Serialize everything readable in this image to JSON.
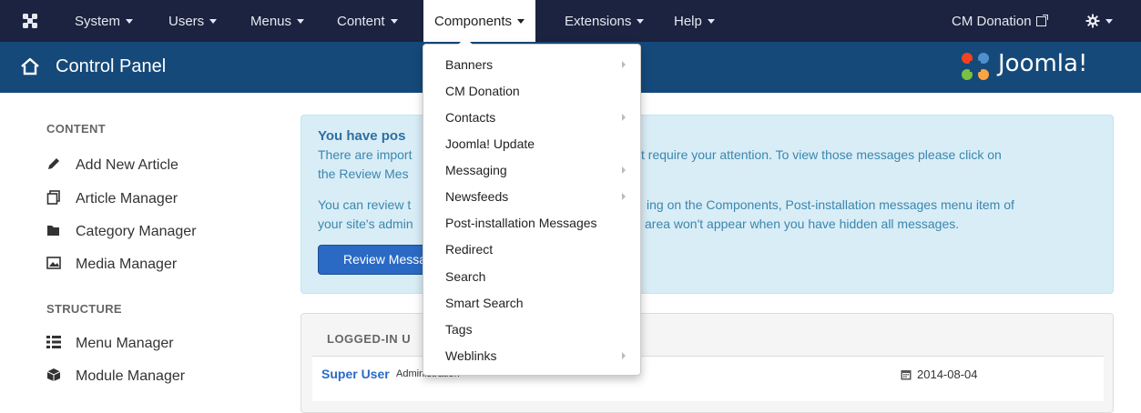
{
  "navbar": {
    "menus": [
      {
        "label": "System"
      },
      {
        "label": "Users"
      },
      {
        "label": "Menus"
      },
      {
        "label": "Content"
      },
      {
        "label": "Components"
      },
      {
        "label": "Extensions"
      },
      {
        "label": "Help"
      }
    ],
    "site_link": "CM Donation",
    "background": "#1b2340"
  },
  "subhead": {
    "title": "Control Panel",
    "brand": "Joomla!"
  },
  "sidebar": {
    "content_heading": "CONTENT",
    "content_items": [
      {
        "label": "Add New Article",
        "icon": "pencil-icon"
      },
      {
        "label": "Article Manager",
        "icon": "stack-icon"
      },
      {
        "label": "Category Manager",
        "icon": "folder-icon"
      },
      {
        "label": "Media Manager",
        "icon": "image-icon"
      }
    ],
    "structure_heading": "STRUCTURE",
    "structure_items": [
      {
        "label": "Menu Manager",
        "icon": "list-icon"
      },
      {
        "label": "Module Manager",
        "icon": "cube-icon"
      }
    ]
  },
  "alert": {
    "title": "You have pos",
    "line1": "There are import",
    "line1b": "t require your attention. To view those messages please click on",
    "line2": "the Review Mes",
    "line3": "You can review t",
    "line3b": "ing on the Components, Post-installation messages menu item of",
    "line4": "your site's admin",
    "line4b": "area won't appear when you have hidden all messages.",
    "button": "Review Messa"
  },
  "logged_in": {
    "heading": "LOGGED-IN U",
    "user": "Super User",
    "role": "Administration",
    "date": "2014-08-04"
  },
  "components_menu": {
    "items": [
      {
        "label": "Banners",
        "submenu": true
      },
      {
        "label": "CM Donation",
        "submenu": false
      },
      {
        "label": "Contacts",
        "submenu": true
      },
      {
        "label": "Joomla! Update",
        "submenu": false
      },
      {
        "label": "Messaging",
        "submenu": true
      },
      {
        "label": "Newsfeeds",
        "submenu": true
      },
      {
        "label": "Post-installation Messages",
        "submenu": false
      },
      {
        "label": "Redirect",
        "submenu": false
      },
      {
        "label": "Search",
        "submenu": false
      },
      {
        "label": "Smart Search",
        "submenu": false
      },
      {
        "label": "Tags",
        "submenu": false
      },
      {
        "label": "Weblinks",
        "submenu": true
      }
    ]
  }
}
